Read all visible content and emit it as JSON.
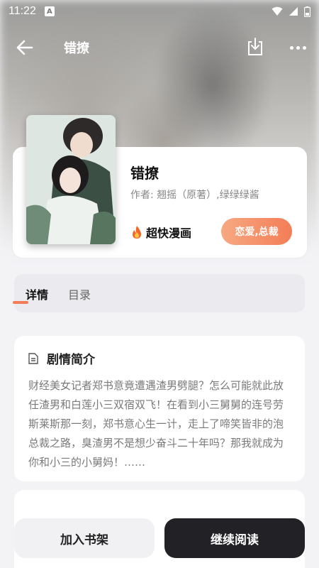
{
  "status_bar": {
    "time": "11:22",
    "notification_badge": "A"
  },
  "header": {
    "title": "错撩"
  },
  "book": {
    "title": "错撩",
    "author": "作者: 翘摇（原著）,绿绿绿酱",
    "publisher": "超快漫画",
    "genre": "恋爱,总裁"
  },
  "tabs": [
    {
      "label": "详情",
      "active": true
    },
    {
      "label": "目录",
      "active": false
    }
  ],
  "synopsis": {
    "title": "剧情简介",
    "text": "财经美女记者郑书意竟遭遇渣男劈腿？怎么可能就此放任渣男和白莲小三双宿双飞！在看到小三舅舅的连号劳斯莱斯那一刻，郑书意心生一计，走上了啼笑皆非的泡总裁之路，臭渣男不是想少奋斗二十年吗？那我就成为你和小三的小舅妈！……"
  },
  "actions": {
    "add_shelf": "加入书架",
    "continue_reading": "继续阅读"
  },
  "colors": {
    "accent": "#f47d57",
    "dark_button": "#222226"
  }
}
